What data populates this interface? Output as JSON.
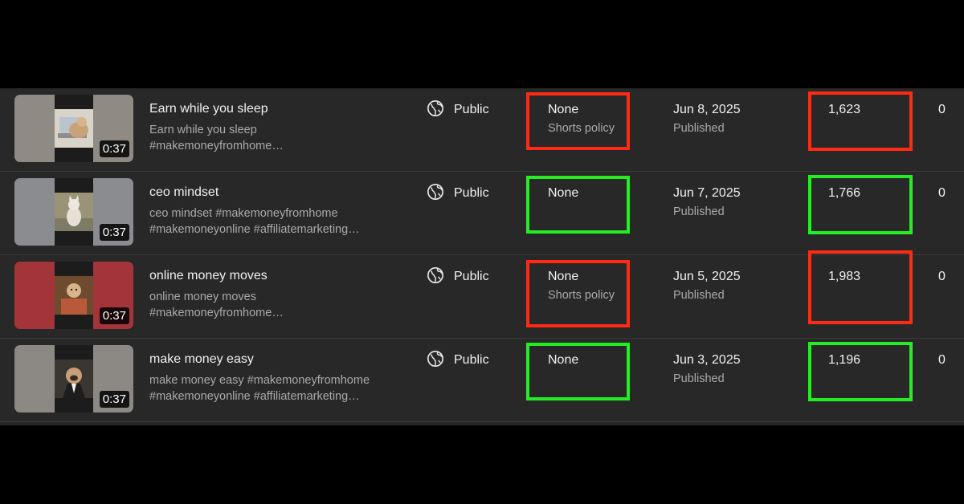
{
  "colors": {
    "flag_red": "#ff2a13",
    "flag_green": "#22ee22",
    "table_bg": "#282828"
  },
  "rows": [
    {
      "title": "Earn while you sleep",
      "desc_line1": "Earn while you sleep",
      "desc_line2": "#makemoneyfromhome…",
      "duration": "0:37",
      "visibility": "Public",
      "visibility_icon": "globe-icon",
      "restriction": "None",
      "restriction_sub": "Shorts policy",
      "restriction_flag": "red",
      "date": "Jun 8, 2025",
      "date_status": "Published",
      "views": "1,623",
      "views_flag": "red",
      "comments": "0",
      "thumb_bg": "#8f8a83"
    },
    {
      "title": "ceo mindset",
      "desc_line1": "ceo mindset #makemoneyfromhome",
      "desc_line2": "#makemoneyonline #affiliatemarketing…",
      "duration": "0:37",
      "visibility": "Public",
      "visibility_icon": "globe-icon",
      "restriction": "None",
      "restriction_sub": "",
      "restriction_flag": "green",
      "date": "Jun 7, 2025",
      "date_status": "Published",
      "views": "1,766",
      "views_flag": "green",
      "comments": "0",
      "thumb_bg": "#8a8c90"
    },
    {
      "title": "online money moves",
      "desc_line1": "online money moves",
      "desc_line2": "#makemoneyfromhome…",
      "duration": "0:37",
      "visibility": "Public",
      "visibility_icon": "globe-icon",
      "restriction": "None",
      "restriction_sub": "Shorts policy",
      "restriction_flag": "red",
      "date": "Jun 5, 2025",
      "date_status": "Published",
      "views": "1,983",
      "views_flag": "red",
      "comments": "0",
      "thumb_bg": "#a3343a"
    },
    {
      "title": "make money easy",
      "desc_line1": "make money easy #makemoneyfromhome",
      "desc_line2": "#makemoneyonline #affiliatemarketing…",
      "duration": "0:37",
      "visibility": "Public",
      "visibility_icon": "globe-icon",
      "restriction": "None",
      "restriction_sub": "",
      "restriction_flag": "green",
      "date": "Jun 3, 2025",
      "date_status": "Published",
      "views": "1,196",
      "views_flag": "green",
      "comments": "0",
      "thumb_bg": "#8c8884"
    }
  ]
}
